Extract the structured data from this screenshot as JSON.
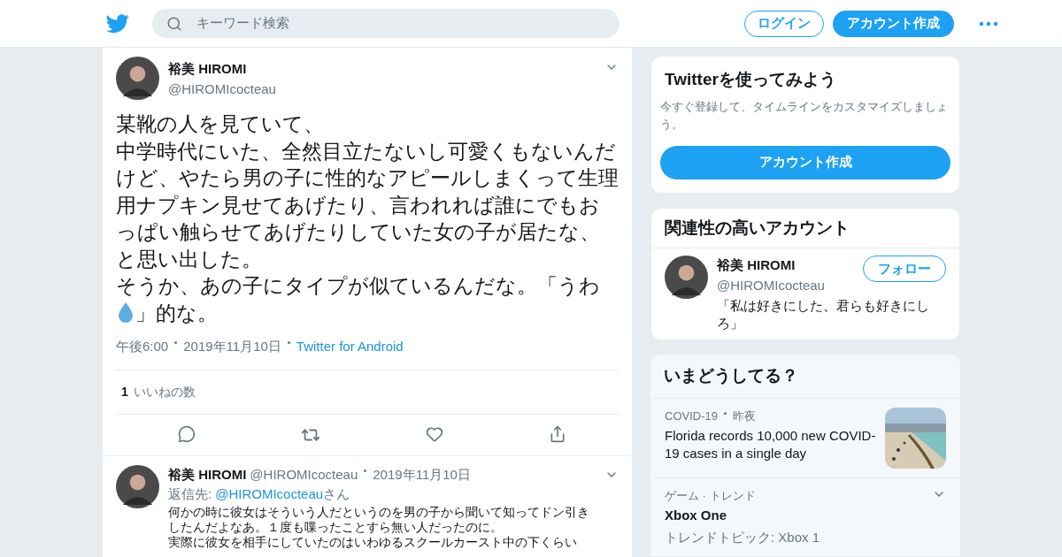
{
  "header": {
    "search_placeholder": "キーワード検索",
    "login": "ログイン",
    "signup": "アカウント作成"
  },
  "tweet": {
    "name": "裕美 HIROMI",
    "handle": "@HIROMIcocteau",
    "paragraphs": [
      [
        {
          "kind": "text",
          "text": "某靴の人を見ていて、"
        }
      ],
      [
        {
          "kind": "text",
          "text": "中学時代にいた、全然目立たないし可愛くもないんだけど、やたら男の子に性的なアピールしまくって生理用ナプキン見せてあげたり、言われれば誰にでもおっぱい触らせてあげたりしていた女の子が居たな、と思い出した。"
        }
      ],
      [
        {
          "kind": "text",
          "text": "そうか、あの子にタイプが似ているんだな。「うわ"
        },
        {
          "kind": "drop"
        },
        {
          "kind": "text",
          "text": "」的な。"
        }
      ]
    ],
    "time": "午後6:00",
    "date": "2019年11月10日",
    "source": "Twitter for Android",
    "like_count": "1",
    "like_label": "いいねの数"
  },
  "reply": {
    "name": "裕美 HIROMI",
    "handle": "@HIROMIcocteau",
    "date": "2019年11月10日",
    "reply_prefix": "返信先:",
    "reply_to": "@HIROMIcocteau",
    "reply_suffix": "さん",
    "paragraphs": [
      "何かの時に彼女はそういう人だというのを男の子から聞いて知ってドン引きしたんだよなあ。１度も喋ったことすら無い人だったのに。",
      "実際に彼女を相手にしていたのはいわゆるスクールカースト中の下くらい"
    ]
  },
  "signup_card": {
    "title": "Twitterを使ってみよう",
    "text": "今すぐ登録して、タイムラインをカスタマイズしましょう。",
    "button": "アカウント作成"
  },
  "related": {
    "title": "関連性の高いアカウント",
    "accounts": [
      {
        "name": "裕美 HIROMI",
        "handle": "@HIROMIcocteau",
        "bio": "「私は好きにした、君らも好きにしろ」",
        "follow": "フォロー"
      }
    ]
  },
  "trends": {
    "title": "いまどうしてる？",
    "items": [
      {
        "kind": "news",
        "topic": "COVID-19",
        "time": "昨夜",
        "headline": "Florida records 10,000 new COVID-19 cases in a single day"
      },
      {
        "kind": "trend",
        "category": "ゲーム · トレンド",
        "name": "Xbox One",
        "sub": "トレンドトピック: Xbox 1"
      }
    ]
  }
}
